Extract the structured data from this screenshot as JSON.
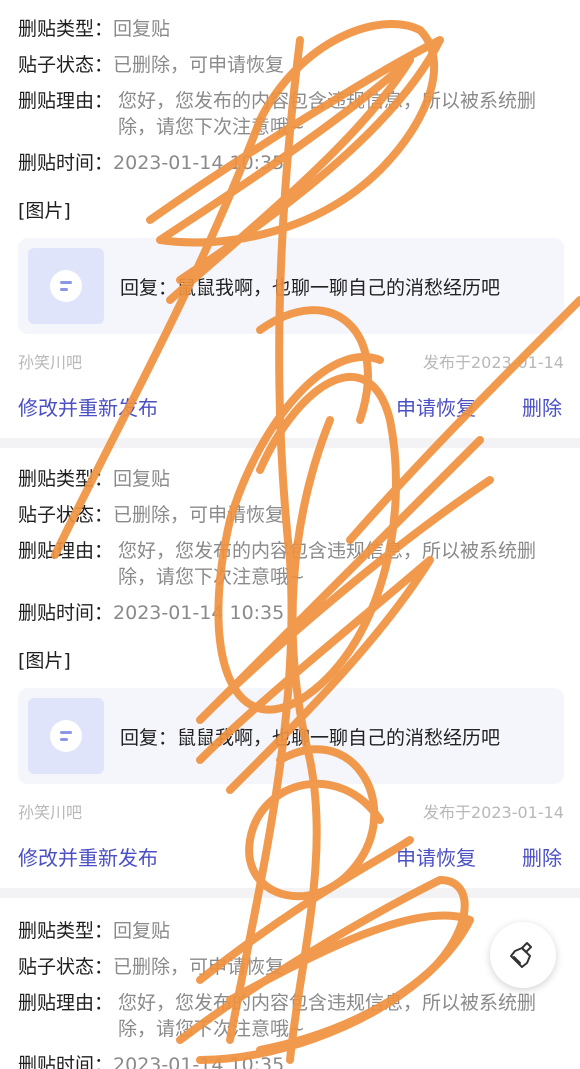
{
  "labels": {
    "type": "删贴类型：",
    "status": "贴子状态：",
    "reason": "删贴理由：",
    "time": "删贴时间：",
    "image": "[图片]"
  },
  "colors": {
    "accent": "#4a4fc4",
    "scribble": "#f0923f",
    "muted": "#8a8a8a"
  },
  "posts": [
    {
      "type": "回复贴",
      "status": "已删除，可申请恢复",
      "reason": "您好，您发布的内容包含违规信息，所以被系统删除，请您下次注意哦~",
      "time": "2023-01-14 10:35",
      "quote": "回复：鼠鼠我啊，也聊一聊自己的消愁经历吧",
      "forum": "孙笑川吧",
      "published": "发布于2023-01-14",
      "actions": {
        "edit": "修改并重新发布",
        "restore": "申请恢复",
        "delete": "删除"
      }
    },
    {
      "type": "回复贴",
      "status": "已删除，可申请恢复",
      "reason": "您好，您发布的内容包含违规信息，所以被系统删除，请您下次注意哦~",
      "time": "2023-01-14 10:35",
      "quote": "回复：鼠鼠我啊，也聊一聊自己的消愁经历吧",
      "forum": "孙笑川吧",
      "published": "发布于2023-01-14",
      "actions": {
        "edit": "修改并重新发布",
        "restore": "申请恢复",
        "delete": "删除"
      }
    },
    {
      "type": "回复贴",
      "status": "已删除，可申请恢复",
      "reason": "您好，您发布的内容包含违规信息，所以被系统删除，请您下次注意哦~",
      "time": "2023-01-14 10:35"
    }
  ],
  "fab": {
    "icon": "broom-icon"
  }
}
